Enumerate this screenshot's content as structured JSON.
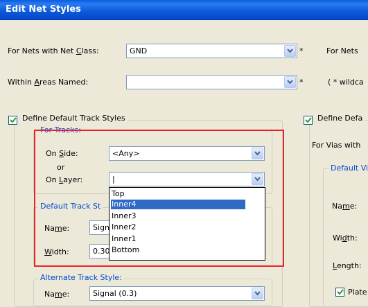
{
  "window": {
    "title": "Edit Net Styles"
  },
  "top": {
    "net_class_label_pre": "For Nets with Net ",
    "net_class_label_u": "C",
    "net_class_label_post": "lass:",
    "net_class_value": "GND",
    "net_class_star": "*",
    "areas_label_pre": "Within ",
    "areas_label_u": "A",
    "areas_label_post": "reas Named:",
    "areas_value": "",
    "areas_star": "*",
    "right_label": "For Nets",
    "wildcard_hint": "( * wildca"
  },
  "track_styles": {
    "checkbox_label": "Define Default Track Styles",
    "checked": true,
    "for_tracks": {
      "title": "For Tracks:",
      "on_side_pre": "On ",
      "on_side_u": "S",
      "on_side_post": "ide:",
      "on_side_value": "<Any>",
      "or": "or",
      "on_layer_pre": "On ",
      "on_layer_u": "L",
      "on_layer_post": "ayer:",
      "on_layer_value": "|",
      "layer_options": [
        "Top",
        "Inner4",
        "Inner3",
        "Inner2",
        "Inner1",
        "Bottom"
      ],
      "selected_option": "Inner4"
    },
    "default_style": {
      "title": "Default Track St",
      "name_label_pre": "Na",
      "name_label_u": "m",
      "name_label_post": "e:",
      "name_value": "Sign",
      "width_label_u": "W",
      "width_label_post": "idth:",
      "width_value": "0.30"
    },
    "alternate_style": {
      "title": "Alternate Track Style:",
      "name_label_pre": "Na",
      "name_label_u": "m",
      "name_label_post": "e:",
      "name_value": "Signal (0.3)"
    }
  },
  "via_styles": {
    "checkbox_label": "Define Defa",
    "checked": true,
    "for_vias_label": "For Vias with",
    "default_via_title": "Default Vi",
    "name_label_pre": "Na",
    "name_label_u": "m",
    "name_label_post": "e:",
    "width_label_pre": "Wi",
    "width_label_u": "d",
    "width_label_post": "th:",
    "length_label_u": "L",
    "length_label_post": "ength:",
    "plated_label": "Plate",
    "plated_checked": true
  }
}
